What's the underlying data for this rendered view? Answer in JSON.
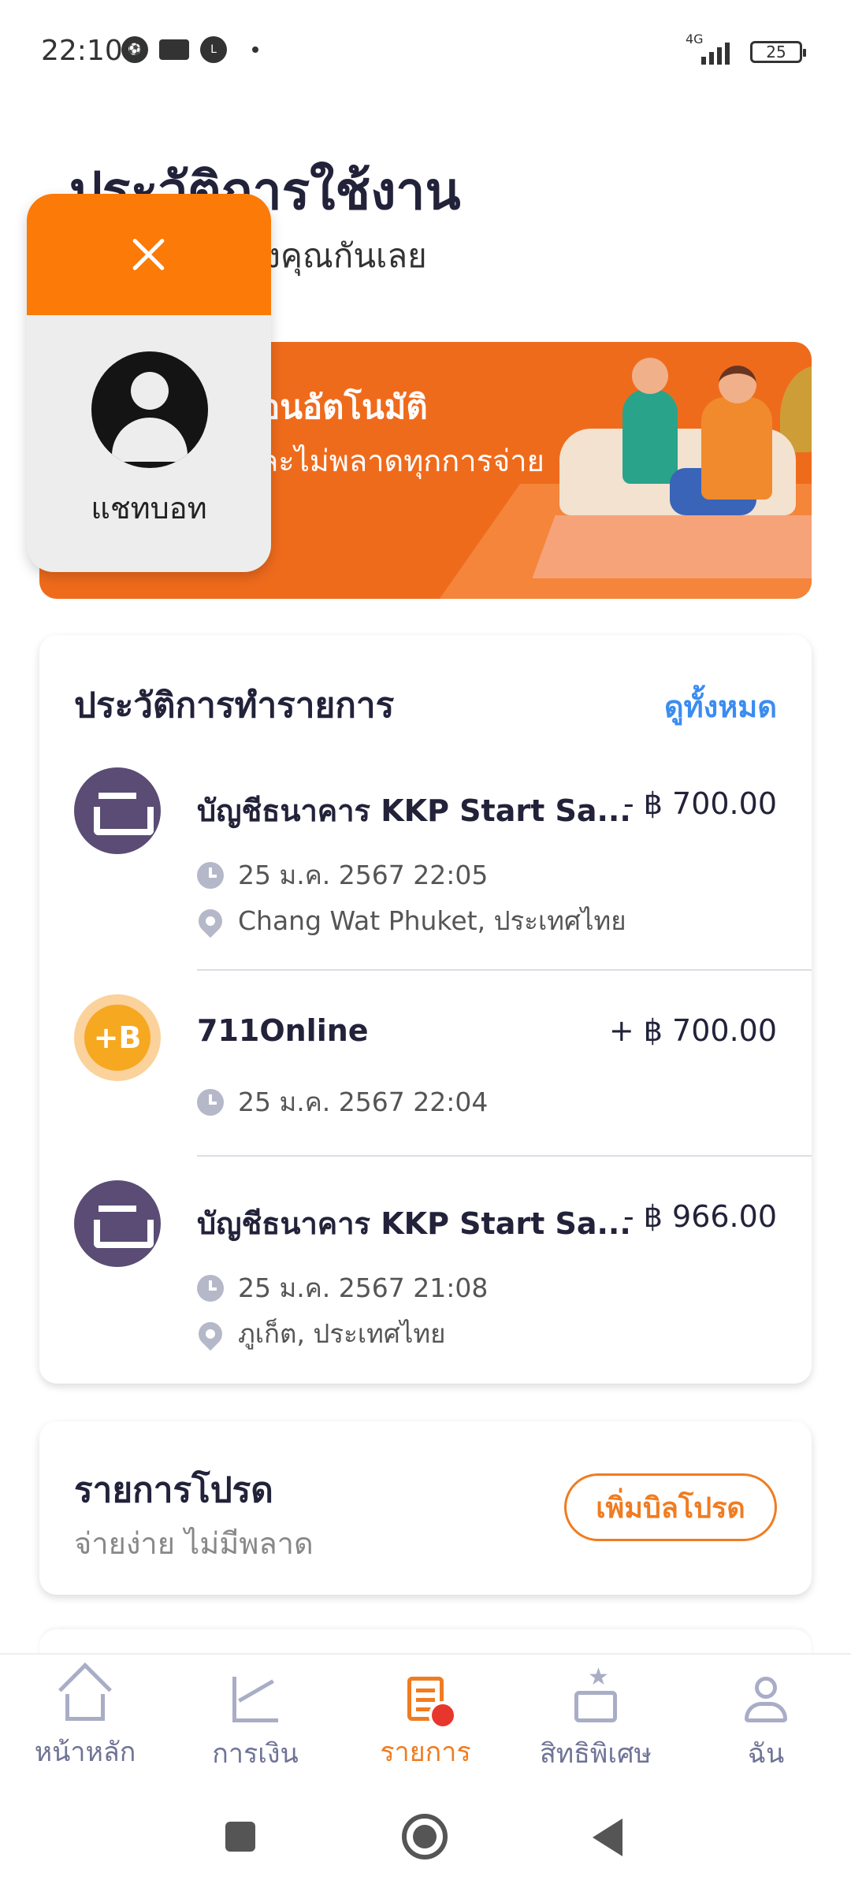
{
  "status_bar": {
    "time": "22:10",
    "network": "4G",
    "battery": "25",
    "app_icons": [
      "soccer-ball-icon",
      "crown-icon",
      "line-icon"
    ]
  },
  "header": {
    "title": "ประวัติการใช้งาน",
    "subtitle": "การใช้จ่ายของคุณกันเลย"
  },
  "banner": {
    "title": "อนอัตโนมัติ",
    "text": "ละไม่พลาดทุกการจ่าย",
    "color": "#ef6b1c"
  },
  "chatbot": {
    "label": "แชทบอท",
    "header_color": "#fb7a08"
  },
  "history": {
    "title": "ประวัติการทำรายการ",
    "see_all": "ดูทั้งหมด",
    "transactions": [
      {
        "name": "บัญชีธนาคาร KKP Start Sa...",
        "amount": "- ฿ 700.00",
        "datetime": "25 ม.ค. 2567 22:05",
        "location": "Chang Wat Phuket, ประเทศไทย",
        "icon": "kkp-bank-icon"
      },
      {
        "name": "711Online",
        "amount": "+ ฿ 700.00",
        "datetime": "25 ม.ค. 2567 22:04",
        "icon": "baht-coin-icon",
        "icon_text": "+B"
      },
      {
        "name": "บัญชีธนาคาร KKP Start Sa...",
        "amount": "- ฿ 966.00",
        "datetime": "25 ม.ค. 2567 21:08",
        "location": "ภูเก็ต, ประเทศไทย",
        "icon": "kkp-bank-icon"
      }
    ]
  },
  "favorite_bills": {
    "title": "รายการโปรด",
    "subtitle": "จ่ายง่าย ไม่มีพลาด",
    "add_button": "เพิ่มบิลโปรด"
  },
  "bottom_nav": {
    "active": "รายการ",
    "accent_color": "#f07c20",
    "items": [
      {
        "label": "หน้าหลัก",
        "icon": "home-icon"
      },
      {
        "label": "การเงิน",
        "icon": "finance-chart-icon"
      },
      {
        "label": "รายการ",
        "icon": "transactions-list-icon"
      },
      {
        "label": "สิทธิพิเศษ",
        "icon": "privileges-gift-icon"
      },
      {
        "label": "ฉัน",
        "icon": "profile-icon"
      }
    ]
  }
}
